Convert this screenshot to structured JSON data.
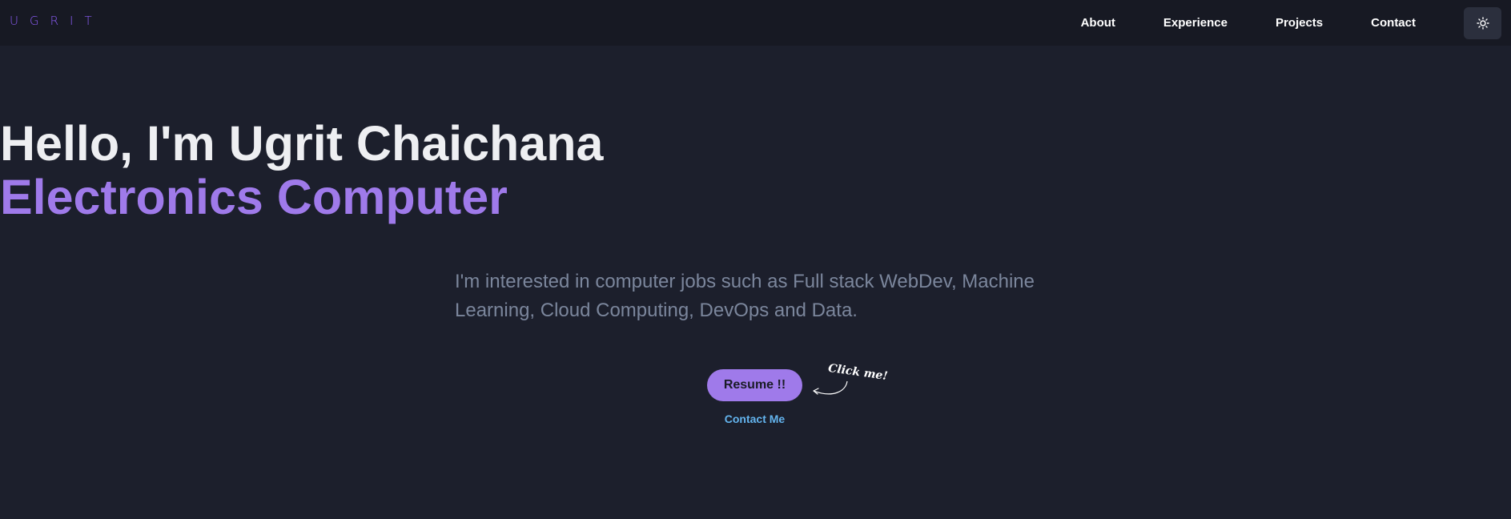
{
  "logo": "UGRIT",
  "nav": {
    "links": [
      "About",
      "Experience",
      "Projects",
      "Contact"
    ],
    "theme_icon": "sun-icon"
  },
  "hero": {
    "title": "Hello, I'm Ugrit Chaichana",
    "subtitle": "Electronics Computer",
    "description": "I'm interested in computer jobs such as Full stack WebDev, Machine Learning, Cloud Computing, DevOps and Data.",
    "resume_button": "Resume !!",
    "contact_link": "Contact Me",
    "click_me": "Click me!"
  },
  "colors": {
    "background": "#1c1f2c",
    "navbar": "#171923",
    "accent": "#9f7aea",
    "link": "#63b3ed",
    "muted_text": "#7b869c"
  }
}
